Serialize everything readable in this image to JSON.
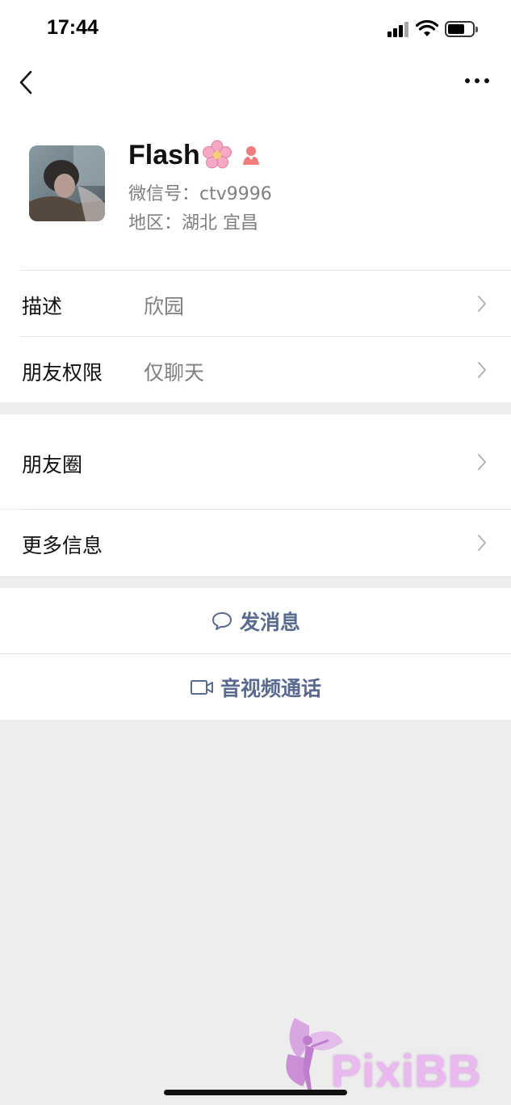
{
  "status_bar": {
    "time": "17:44"
  },
  "nav": {
    "back_icon": "chevron-left-icon",
    "more_icon": "ellipsis-icon"
  },
  "profile": {
    "name": "Flash",
    "name_emoji": "cherry-blossom-icon",
    "gender_icon": "female-icon",
    "wechat_id_label": "微信号：",
    "wechat_id_value": "ctv9996",
    "region_label": "地区：",
    "region_value": "湖北 宜昌"
  },
  "info_rows": [
    {
      "label": "描述",
      "value": "欣园"
    },
    {
      "label": "朋友权限",
      "value": "仅聊天"
    }
  ],
  "more_rows": [
    {
      "label": "朋友圈"
    },
    {
      "label": "更多信息"
    }
  ],
  "actions": {
    "message_label": "发消息",
    "message_icon": "chat-bubble-icon",
    "call_label": "音视频通话",
    "call_icon": "video-camera-icon"
  },
  "watermark": {
    "text": "PixiBB"
  },
  "colors": {
    "link_blue": "#586a8f",
    "secondary_text": "#7f7f7f",
    "page_bg": "#ededed",
    "female_icon": "#f07c7c"
  }
}
